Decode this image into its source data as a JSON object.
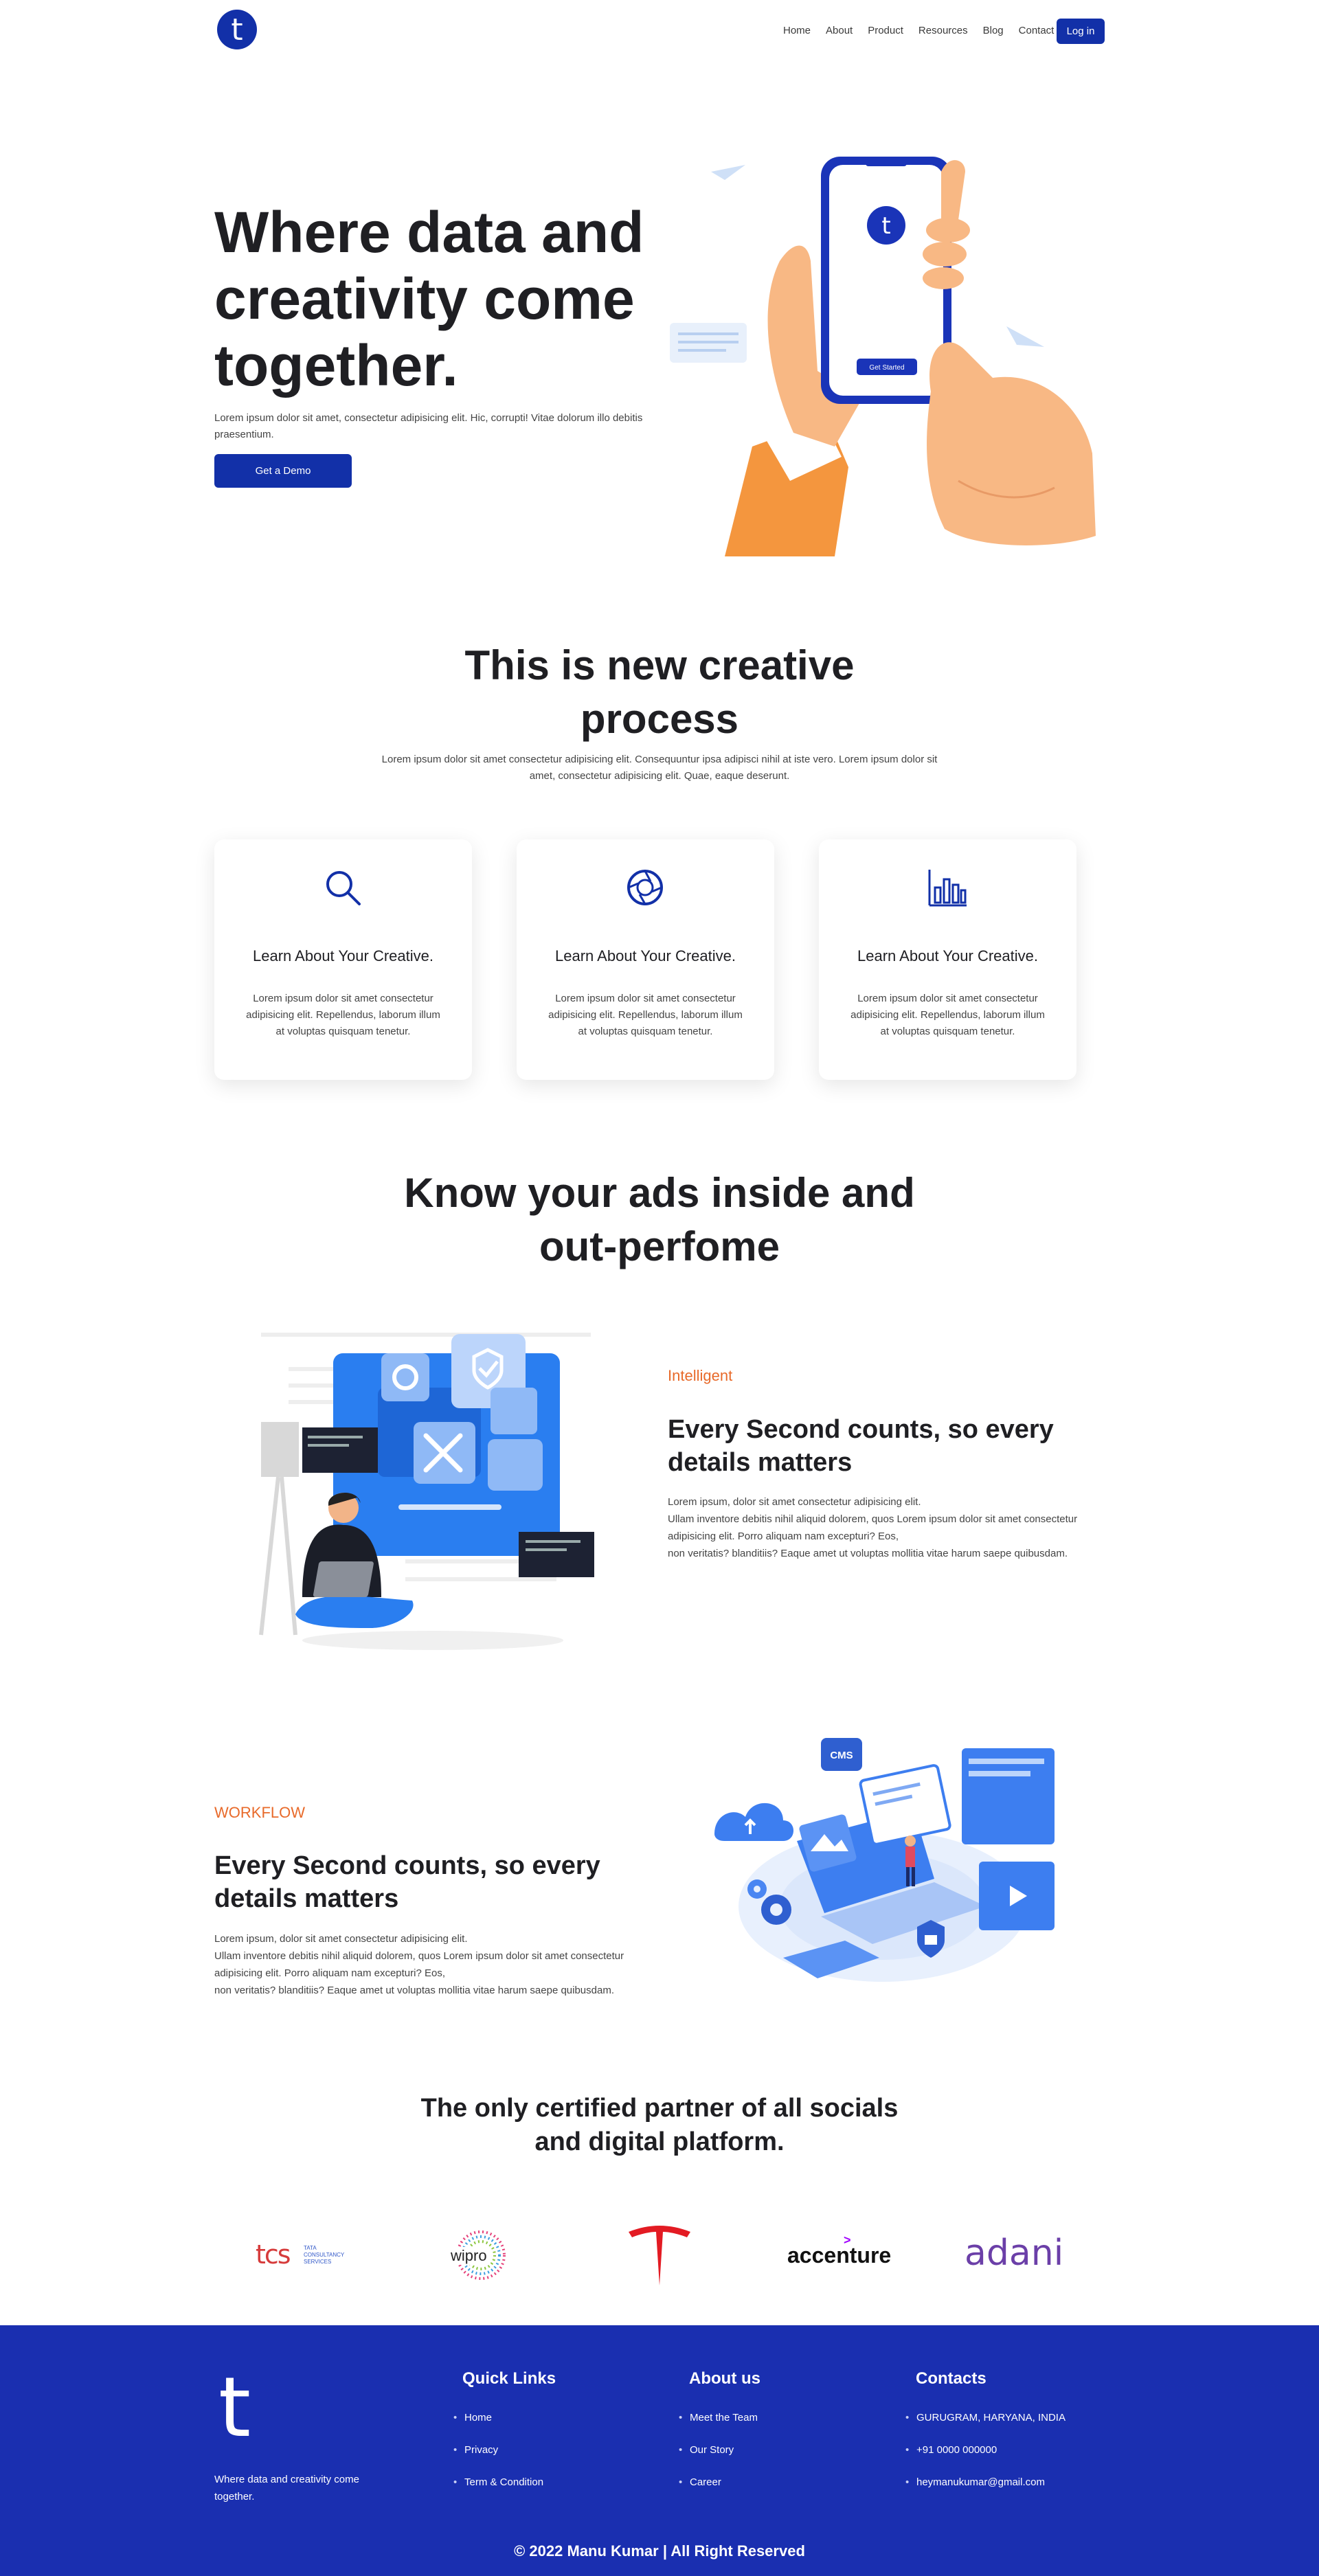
{
  "nav": {
    "logo": "t",
    "links": [
      "Home",
      "About",
      "Product",
      "Resources",
      "Blog",
      "Contact"
    ],
    "login": "Log in"
  },
  "hero": {
    "title": "Where data and creativity come together.",
    "text": "Lorem ipsum dolor sit amet, consectetur adipisicing elit. Hic, corrupti! Vitae dolorum illo debitis praesentium.",
    "button": "Get a Demo",
    "phone_logo": "t",
    "phone_button": "Get Started"
  },
  "process": {
    "title": "This is new creative process",
    "text": "Lorem ipsum dolor sit amet consectetur adipisicing elit. Consequuntur ipsa adipisci nihil at iste vero. Lorem ipsum dolor sit amet, consectetur adipisicing elit. Quae, eaque deserunt.",
    "cards": [
      {
        "icon": "search-icon",
        "title": "Learn About Your Creative.",
        "text": "Lorem ipsum dolor sit amet consectetur adipisicing elit. Repellendus, laborum illum at voluptas quisquam tenetur."
      },
      {
        "icon": "aperture-icon",
        "title": "Learn About Your Creative.",
        "text": "Lorem ipsum dolor sit amet consectetur adipisicing elit. Repellendus, laborum illum at voluptas quisquam tenetur."
      },
      {
        "icon": "bar-chart-icon",
        "title": "Learn About Your Creative.",
        "text": "Lorem ipsum dolor sit amet consectetur adipisicing elit. Repellendus, laborum illum at voluptas quisquam tenetur."
      }
    ]
  },
  "ads": {
    "title": "Know your ads inside and out-perfome"
  },
  "feature1": {
    "label": "Intelligent",
    "title": "Every Second counts, so every details matters",
    "text1": "Lorem ipsum, dolor sit amet consectetur adipisicing elit.",
    "text2": "Ullam inventore debitis nihil aliquid dolorem, quos Lorem ipsum dolor sit amet consectetur adipisicing elit. Porro aliquam nam excepturi? Eos,",
    "text3": "non veritatis? blanditiis? Eaque amet ut voluptas mollitia vitae harum saepe quibusdam."
  },
  "feature2": {
    "label": "WORKFLOW",
    "title": "Every Second counts, so every details matters",
    "text1": "Lorem ipsum, dolor sit amet consectetur adipisicing elit.",
    "text2": "Ullam inventore debitis nihil aliquid dolorem, quos Lorem ipsum dolor sit amet consectetur adipisicing elit. Porro aliquam nam excepturi? Eos,",
    "text3": "non veritatis? blanditiis? Eaque amet ut voluptas mollitia vitae harum saepe quibusdam.",
    "cms_badge": "CMS"
  },
  "partners": {
    "title": "The only certified partner of all socials and digital platform.",
    "logos": {
      "tcs_mark": "tcs",
      "tcs_line1": "TATA",
      "tcs_line2": "CONSULTANCY",
      "tcs_line3": "SERVICES",
      "wipro": "wipro",
      "accenture": "accenture",
      "adani": "adani"
    }
  },
  "footer": {
    "logo": "t",
    "tagline": "Where data and creativity come together.",
    "quick_links_title": "Quick Links",
    "quick_links": [
      "Home",
      "Privacy",
      "Term & Condition"
    ],
    "about_title": "About us",
    "about_links": [
      "Meet the Team",
      "Our Story",
      "Career"
    ],
    "contacts_title": "Contacts",
    "contacts": [
      "GURUGRAM, HARYANA, INDIA",
      "+91 0000 000000",
      "heymanukumar@gmail.com"
    ],
    "copyright": "© 2022 Manu Kumar | All Right Reserved"
  },
  "colors": {
    "primary": "#1230a8",
    "accent": "#e86a2a",
    "footer_bg": "#1a2fb0"
  }
}
